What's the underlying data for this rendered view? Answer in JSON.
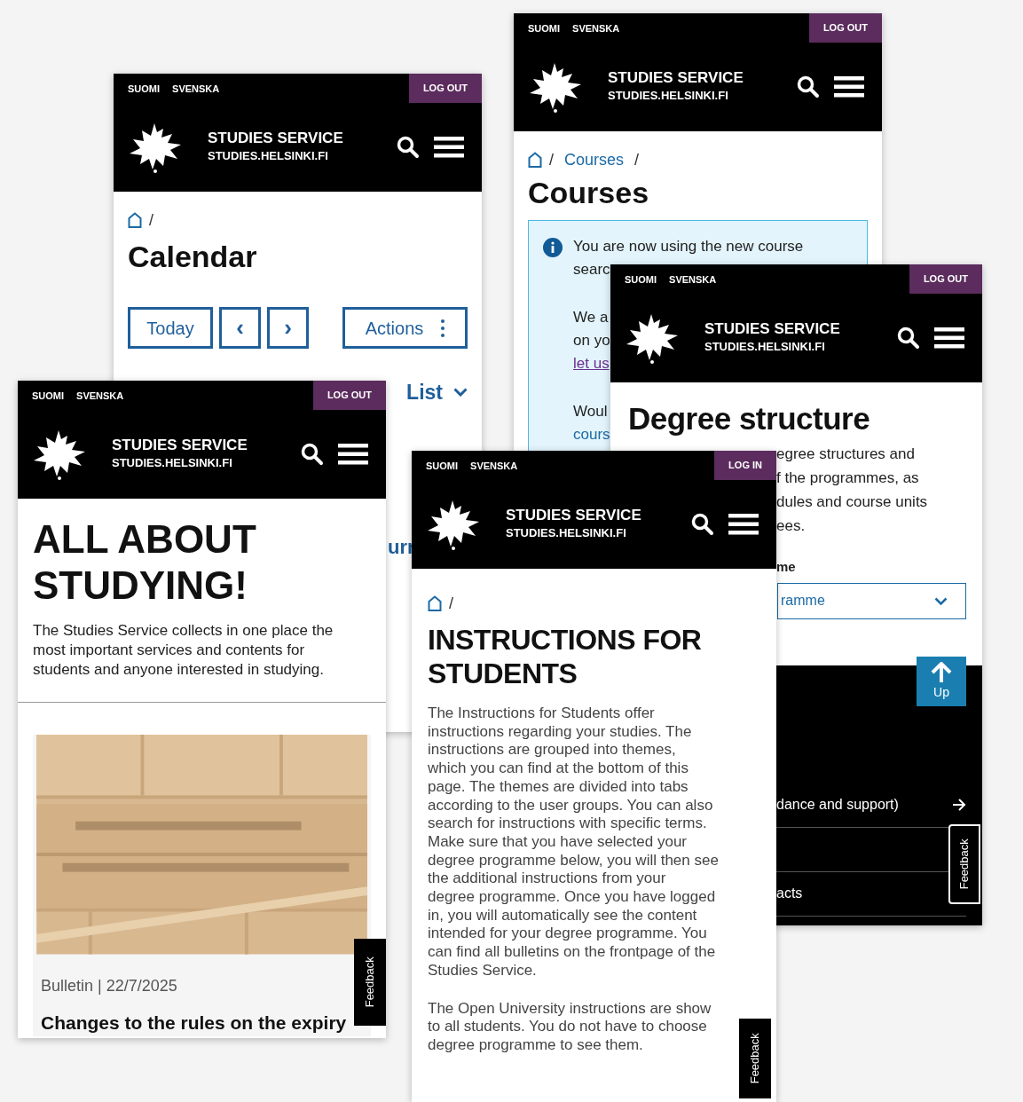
{
  "screens": [
    {
      "kind": "calendar",
      "header": {
        "languages": [
          "SUOMI",
          "SVENSKA"
        ],
        "account_button": "LOG OUT",
        "title": "STUDIES SERVICE",
        "subtitle": "STUDIES.HELSINKI.FI"
      },
      "breadcrumb": [
        "/"
      ],
      "heading": "Calendar",
      "buttons": [
        "Today",
        "‹",
        "›"
      ],
      "actions_button": "Actions",
      "view_toggle": "List",
      "fragment": "urr"
    },
    {
      "kind": "courses",
      "header": {
        "languages": [
          "SUOMI",
          "SVENSKA"
        ],
        "account_button": "LOG OUT",
        "title": "STUDIES SERVICE",
        "subtitle": "STUDIES.HELSINKI.FI"
      },
      "breadcrumb": [
        "/",
        "Courses",
        "/"
      ],
      "heading": "Courses",
      "notice": {
        "paragraphs": [
          {
            "lines": [
              "You are now using the new course",
              "searc"
            ]
          },
          {
            "lines": [
              "We a",
              "on yo"
            ],
            "link": "let us"
          },
          {
            "lines": [
              "Woul"
            ],
            "link": "cours"
          }
        ]
      }
    },
    {
      "kind": "degree",
      "header": {
        "languages": [
          "SUOMI",
          "SVENSKA"
        ],
        "account_button": "LOG OUT",
        "title": "STUDIES SERVICE",
        "subtitle": "STUDIES.HELSINKI.FI"
      },
      "heading": "Degree structure",
      "intro_lines": [
        "egree structures and",
        "f the programmes, as",
        "dules and course units",
        "ees."
      ],
      "select_label": "me",
      "select_value": "ramme",
      "up_button": "Up",
      "footer_links": [
        {
          "label": "dance and support)",
          "arrow": true
        },
        {
          "label": "acts"
        }
      ],
      "feedback": "Feedback"
    },
    {
      "kind": "front",
      "header": {
        "languages": [
          "SUOMI",
          "SVENSKA"
        ],
        "account_button": "LOG OUT",
        "title": "STUDIES SERVICE",
        "subtitle": "STUDIES.HELSINKI.FI"
      },
      "heading_lines": [
        "ALL ABOUT",
        "STUDYING!"
      ],
      "intro_lines": [
        "The Studies Service collects in one place the",
        "most important services and contents for",
        "students and anyone interested in studying."
      ],
      "card": {
        "kind": "picture",
        "category": "Bulletin",
        "separator": "|",
        "date": "22/7/2025",
        "title": "Changes to the rules on the expiry"
      },
      "feedback": "Feedback"
    },
    {
      "kind": "instructions",
      "header": {
        "languages": [
          "SUOMI",
          "SVENSKA"
        ],
        "account_button": "LOG IN",
        "title": "STUDIES SERVICE",
        "subtitle": "STUDIES.HELSINKI.FI"
      },
      "breadcrumb": [
        "/"
      ],
      "heading_lines": [
        "INSTRUCTIONS FOR",
        "STUDENTS"
      ],
      "paragraphs": [
        [
          "The Instructions for Students offer",
          "instructions regarding your studies. The",
          "instructions are grouped into themes,",
          "which you can find at the bottom of this",
          "page. The themes are divided into tabs",
          "according to the user groups. You can also",
          "search for instructions with specific terms.",
          "Make sure that you have selected your",
          "degree programme below, you will then see",
          "the additional instructions from your",
          "degree programme. Once you have logged",
          "in, you will automatically see the content",
          "intended for your degree programme. You",
          "can find all bulletins on the frontpage of the",
          "Studies Service."
        ],
        [
          "The Open University instructions are show",
          "to all students. You do not have to choose",
          "degree programme to see them."
        ]
      ],
      "feedback": "Feedback"
    }
  ]
}
